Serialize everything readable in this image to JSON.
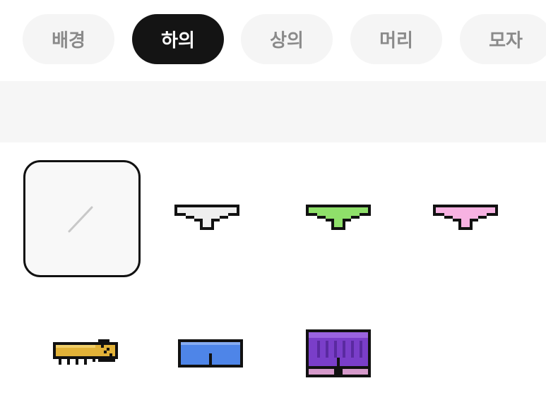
{
  "tabs": [
    {
      "label": "배경",
      "active": false
    },
    {
      "label": "하의",
      "active": true
    },
    {
      "label": "상의",
      "active": false
    },
    {
      "label": "머리",
      "active": false
    },
    {
      "label": "모자",
      "active": false
    }
  ],
  "items": [
    {
      "name": "none",
      "selected": true,
      "icon": "none-slash-icon"
    },
    {
      "name": "underwear-white",
      "icon": "underwear-icon",
      "color": "#eeeeee"
    },
    {
      "name": "underwear-green",
      "icon": "underwear-icon",
      "color": "#8fe06a"
    },
    {
      "name": "underwear-pink",
      "icon": "underwear-icon",
      "color": "#f7b2e2"
    },
    {
      "name": "skirt-gold",
      "icon": "grass-skirt-icon",
      "color": "#e2b238"
    },
    {
      "name": "shorts-blue",
      "icon": "shorts-icon",
      "color": "#4e85e8"
    },
    {
      "name": "skirt-purple",
      "icon": "long-skirt-icon",
      "color": "#7a3ec9"
    }
  ],
  "colors": {
    "active_tab_bg": "#141414",
    "inactive_tab_bg": "#f5f5f5",
    "inactive_tab_text": "#8a8a8a",
    "outline": "#111111"
  }
}
